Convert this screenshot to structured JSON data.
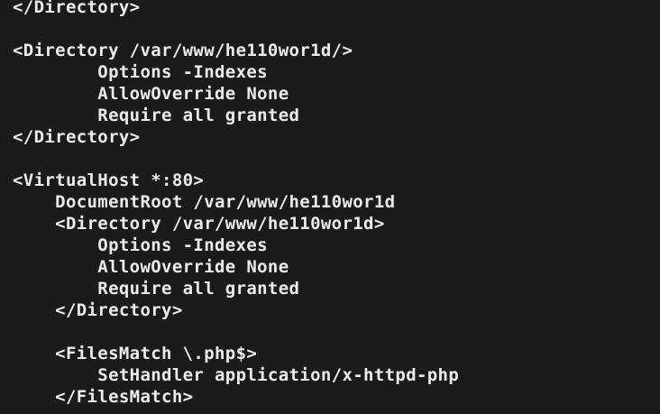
{
  "editor": {
    "lines": [
      "</Directory>",
      "",
      "<Directory /var/www/he110wor1d/>",
      "        Options -Indexes",
      "        AllowOverride None",
      "        Require all granted",
      "</Directory>",
      "",
      "<VirtualHost *:80>",
      "    DocumentRoot /var/www/he110wor1d",
      "    <Directory /var/www/he110wor1d>",
      "        Options -Indexes",
      "        AllowOverride None",
      "        Require all granted",
      "    </Directory>",
      "",
      "    <FilesMatch \\.php$>",
      "        SetHandler application/x-httpd-php",
      "    </FilesMatch>"
    ]
  }
}
